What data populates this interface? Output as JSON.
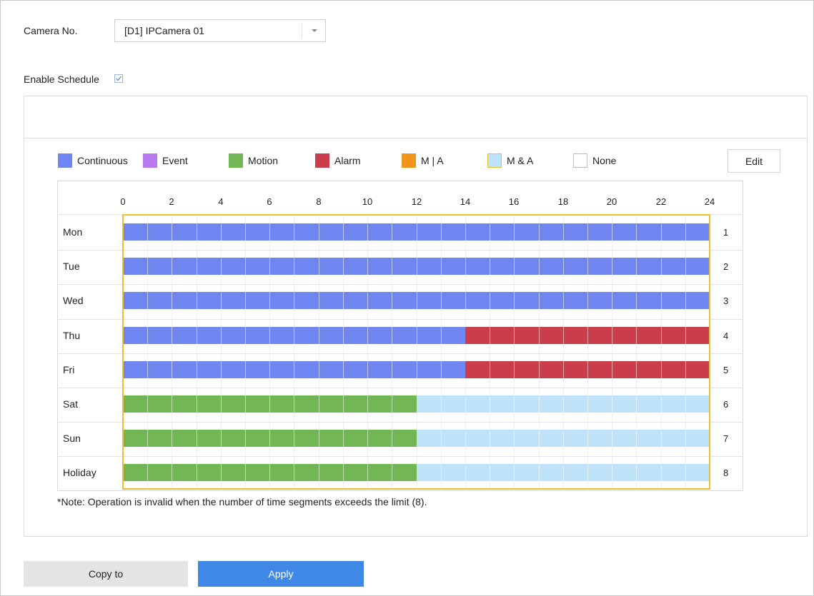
{
  "camera": {
    "label": "Camera No.",
    "selected": "[D1] IPCamera 01"
  },
  "enable_schedule": {
    "label": "Enable Schedule",
    "checked": true
  },
  "legend": [
    {
      "label": "Continuous",
      "color": "#6f86f0",
      "border": "#6f86f0"
    },
    {
      "label": "Event",
      "color": "#b97af0",
      "border": "#b97af0"
    },
    {
      "label": "Motion",
      "color": "#72b656",
      "border": "#72b656"
    },
    {
      "label": "Alarm",
      "color": "#cc3d4b",
      "border": "#cc3d4b"
    },
    {
      "label": "M | A",
      "color": "#ef9618",
      "border": "#ef9618"
    },
    {
      "label": "M & A",
      "color": "#bfe3f8",
      "border": "#f1bd34"
    },
    {
      "label": "None",
      "color": "#ffffff",
      "border": "#bbbbbb"
    }
  ],
  "edit_label": "Edit",
  "hours": [
    "0",
    "2",
    "4",
    "6",
    "8",
    "10",
    "12",
    "14",
    "16",
    "18",
    "20",
    "22",
    "24"
  ],
  "rows": [
    {
      "day": "Mon",
      "num": "1",
      "segments": [
        {
          "start": 0,
          "end": 24,
          "type": "Continuous"
        }
      ]
    },
    {
      "day": "Tue",
      "num": "2",
      "segments": [
        {
          "start": 0,
          "end": 24,
          "type": "Continuous"
        }
      ]
    },
    {
      "day": "Wed",
      "num": "3",
      "segments": [
        {
          "start": 0,
          "end": 24,
          "type": "Continuous"
        }
      ]
    },
    {
      "day": "Thu",
      "num": "4",
      "segments": [
        {
          "start": 0,
          "end": 14,
          "type": "Continuous"
        },
        {
          "start": 14,
          "end": 24,
          "type": "Alarm"
        }
      ]
    },
    {
      "day": "Fri",
      "num": "5",
      "segments": [
        {
          "start": 0,
          "end": 14,
          "type": "Continuous"
        },
        {
          "start": 14,
          "end": 24,
          "type": "Alarm"
        }
      ]
    },
    {
      "day": "Sat",
      "num": "6",
      "segments": [
        {
          "start": 0,
          "end": 12,
          "type": "Motion"
        },
        {
          "start": 12,
          "end": 24,
          "type": "M & A"
        }
      ]
    },
    {
      "day": "Sun",
      "num": "7",
      "segments": [
        {
          "start": 0,
          "end": 12,
          "type": "Motion"
        },
        {
          "start": 12,
          "end": 24,
          "type": "M & A"
        }
      ]
    },
    {
      "day": "Holiday",
      "num": "8",
      "segments": [
        {
          "start": 0,
          "end": 12,
          "type": "Motion"
        },
        {
          "start": 12,
          "end": 24,
          "type": "M & A"
        }
      ]
    }
  ],
  "note": "*Note: Operation is invalid when the number of time segments exceeds the limit (8).",
  "buttons": {
    "copy": "Copy to",
    "apply": "Apply"
  }
}
